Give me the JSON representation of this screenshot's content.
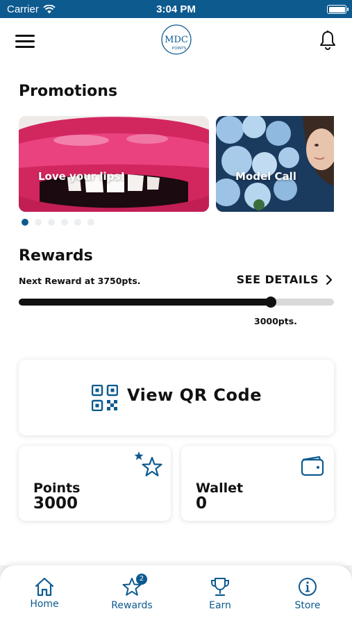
{
  "status_bar": {
    "carrier": "Carrier",
    "time": "3:04 PM"
  },
  "header": {
    "logo_text": "MDC",
    "logo_subtext": "POINTS"
  },
  "promotions": {
    "title": "Promotions",
    "cards": [
      {
        "label": "Love your lips!"
      },
      {
        "label": "Model Call"
      }
    ],
    "page_count": 6,
    "active_page": 0
  },
  "rewards": {
    "title": "Rewards",
    "next_reward_text": "Next Reward at 3750pts.",
    "see_details_label": "SEE DETAILS",
    "progress_value_text": "3000pts.",
    "progress_fraction": 0.8
  },
  "qr": {
    "label": "View QR Code"
  },
  "points": {
    "label": "Points",
    "value": "3000"
  },
  "wallet": {
    "label": "Wallet",
    "value": "0"
  },
  "tabs": [
    {
      "label": "Home",
      "icon": "home-icon"
    },
    {
      "label": "Rewards",
      "icon": "star-icon",
      "badge": "2"
    },
    {
      "label": "Earn",
      "icon": "trophy-icon"
    },
    {
      "label": "Store",
      "icon": "info-icon"
    }
  ],
  "colors": {
    "brand": "#0d5a8f",
    "text": "#111111",
    "track": "#d9d9d9"
  }
}
